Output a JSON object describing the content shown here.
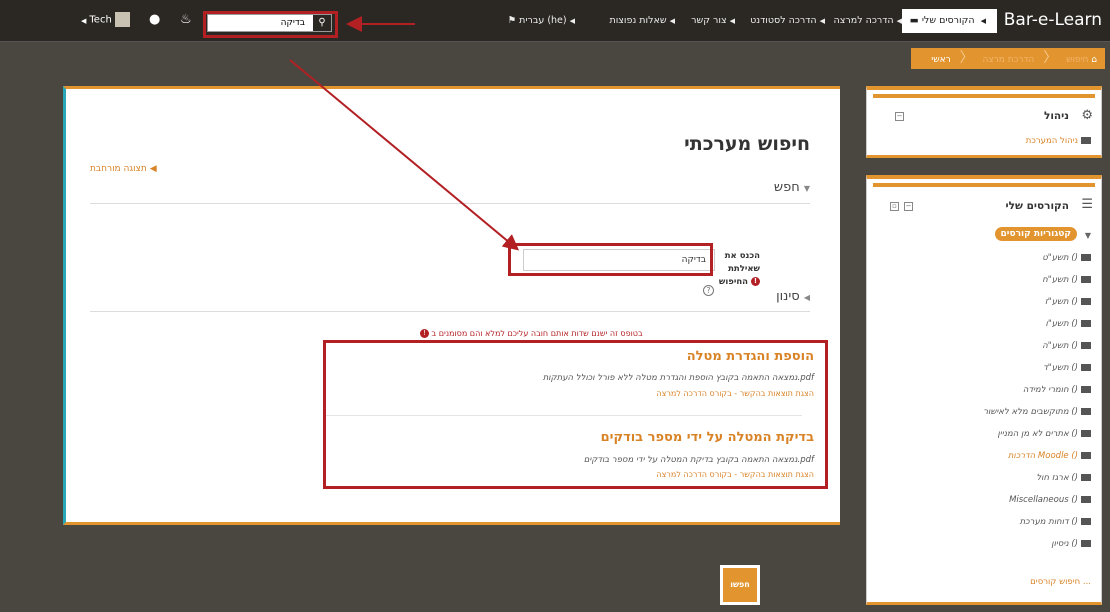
{
  "navbar": {
    "brand": "Bar-e-Learn",
    "items": [
      {
        "label": "הקורסים שלי",
        "active": true
      },
      {
        "label": "הדרכה למרצה"
      },
      {
        "label": "הדרכה לסטודנט"
      },
      {
        "label": "צור קשר"
      },
      {
        "label": "שאלות נפוצות"
      },
      {
        "label": "עברית (he)"
      }
    ],
    "search": {
      "value": "בדיקה"
    },
    "user": {
      "name": "Tech"
    }
  },
  "breadcrumb": {
    "home": "ראשי",
    "middle": "הדרכת מרצה",
    "current": "חיפוש"
  },
  "main": {
    "page_title": "חיפוש מערכתי",
    "advanced_link": "תצוגה מורחבת",
    "search_section": "חפש",
    "query_label_line1": "הכנס את שאילתת",
    "query_label_line2": "החיפוש",
    "query_value": "בדיקה",
    "filter_section": "סינון",
    "required_note": "בטופס זה ישנם שדות אותם חובה עליכם למלא והם מסומנים ב",
    "results": [
      {
        "title": "הוספת והגדרת מטלה",
        "snippet": "נמצאה התאמה בקובץ הוספת והגדרת מטלה ללא פורל וכולל העתקות.pdf",
        "link": "הצגת תוצאות בהקשר - בקורס הדרכה למרצה"
      },
      {
        "title": "בדיקת המטלה על ידי מספר בודקים",
        "snippet": "נמצאה התאמה בקובץ בדיקת המטלה על ידי מספר בודקים.pdf",
        "link": "הצגת תוצאות בהקשר - בקורס הדרכה למרצה"
      }
    ],
    "submit_label": "חפשו"
  },
  "admin_block": {
    "title": "ניהול",
    "link": "ניהול המערכת"
  },
  "courses_block": {
    "title": "הקורסים שלי",
    "category_badge": "קטגוריות קורסים",
    "items": [
      "תשע\"ט ()",
      "תשע\"ח ()",
      "תשע\"ז ()",
      "תשע\"ו ()",
      "תשע\"ה ()",
      "תשע\"ד ()",
      "חומרי למידה ()",
      "מתוקשבים מלא לאישור ()",
      "אתרים לא מן המניין ()",
      "הדרכות Moodle ()",
      "ארגז חול ()",
      "Miscellaneous ()",
      "דוחות מערכת ()",
      "ניסיון ()"
    ],
    "search_courses": "חיפוש קורסים ..."
  },
  "colors": {
    "accent": "#e2952f",
    "highlight": "#b22024",
    "teal": "#2aa6b9",
    "navbar": "#2b2824"
  }
}
